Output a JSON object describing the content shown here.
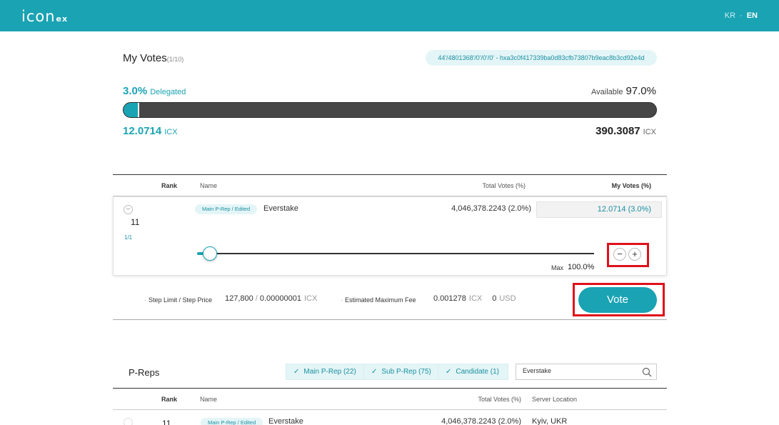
{
  "header": {
    "logo_main": "icon",
    "logo_sub": "ex",
    "lang_kr": "KR",
    "lang_sep": "·",
    "lang_en": "EN"
  },
  "my_votes": {
    "title": "My Votes",
    "count": "(1/10)",
    "wallet_address": "44'/4801368'/0'/0'/0' - hxa3c0f417339ba0d83cfb73807b9eac8b3cd92e4d",
    "delegated_pct": "3.0%",
    "delegated_label": "Delegated",
    "available_label": "Available",
    "available_pct": "97.0%",
    "delegated_fraction": 0.03,
    "delegated_amount": "12.0714",
    "available_amount": "390.3087",
    "unit": "ICX"
  },
  "vote_table": {
    "headers": {
      "rank": "Rank",
      "name": "Name",
      "total_votes": "Total Votes (%)",
      "my_votes": "My Votes (%)"
    },
    "row": {
      "rank": "11",
      "page": "1/1",
      "badge": "Main P-Rep / Edited",
      "name": "Everstake",
      "total_votes": "4,046,378.2243 (2.0%)",
      "my_vote": "12.0714 (3.0%)",
      "slider_fraction": 0.03,
      "max_label": "Max",
      "max_value": "100.0%",
      "minus_symbol": "−",
      "plus_symbol": "+"
    }
  },
  "fees": {
    "step_label": "Step Limit / Step Price",
    "step_limit": "127,800",
    "step_sep": "/",
    "step_price": "0.00000001",
    "step_unit": "ICX",
    "fee_label": "Estimated Maximum Fee",
    "fee_icx": "0.001278",
    "fee_icx_unit": "ICX",
    "fee_usd": "0",
    "fee_usd_unit": "USD"
  },
  "vote_button": "Vote",
  "preps": {
    "title": "P-Reps",
    "filters": [
      "Main P-Rep (22)",
      "Sub P-Rep (75)",
      "Candidate (1)"
    ],
    "search_value": "Everstake",
    "headers": {
      "rank": "Rank",
      "name": "Name",
      "total_votes": "Total Votes (%)",
      "server": "Server Location"
    },
    "rows": [
      {
        "rank": "11",
        "badge": "Main P-Rep / Edited",
        "name": "Everstake",
        "total_votes": "4,046,378.2243 (2.0%)",
        "server": "Kyiv, UKR"
      }
    ]
  },
  "colors": {
    "accent": "#1aa3b3",
    "bar_bg": "#464646",
    "highlight": "#e0101a"
  }
}
